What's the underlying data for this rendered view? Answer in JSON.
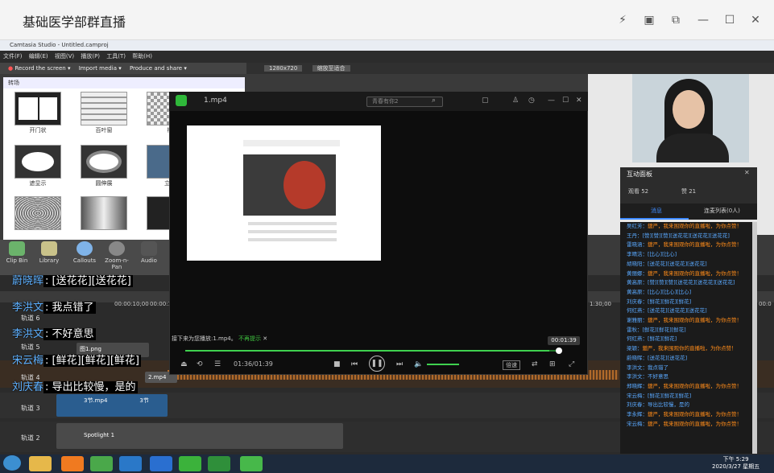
{
  "window": {
    "title": "基础医学部群直播"
  },
  "camtasia": {
    "title": "Camtasia Studio - Untitled.camproj",
    "menu": [
      "文件(F)",
      "编辑(E)",
      "视图(V)",
      "播放(P)",
      "工具(T)",
      "帮助(H)"
    ],
    "toolbar": [
      "Record the screen ▾",
      "Import media ▾",
      "Produce and share ▾"
    ],
    "resolution": "1280x720",
    "zoom": "缩放至适合",
    "gallery_header": "转场",
    "transitions": [
      "开门状",
      "百叶窗",
      "椭",
      "遮显示",
      "圆伸展",
      "立方",
      "",
      "",
      ""
    ],
    "tasks": [
      "Clip Bin",
      "Library",
      "Callouts",
      "Zoom-n-Pan",
      "Audio"
    ],
    "tracks": [
      "轨道 6",
      "轨道 5",
      "轨道 4",
      "轨道 3",
      "轨道 2"
    ],
    "timecodes": [
      "00:00:10;00",
      "00:00:1",
      "1:30;00",
      "00:0"
    ],
    "clips": [
      "3节.mp4",
      "3节",
      "Spotlight 1",
      "图1.png",
      "2.mp4"
    ]
  },
  "player": {
    "file": "1.mp4",
    "search_placeholder": "青春有你2",
    "next_note": "接下来为您播放:1.mp4。",
    "next_note_link": "不再提示",
    "time_badge": "00:01:39",
    "time": "01:36/01:39",
    "progress": 0.97,
    "speed": "倍速"
  },
  "panel": {
    "title": "互动面板",
    "viewers": "观看 52",
    "likes": "赞 21",
    "tab_messages": "消息",
    "tab_mic": "连麦列表(0人)"
  },
  "chat": [
    {
      "name": "吴红芳",
      "text": "鍍严，我来围观你的直播啦，为你点赞！",
      "color": "#ff8c1a"
    },
    {
      "name": "王丹",
      "text": "[赞][赞][赞][送花花][送花花][送花花]",
      "color": "#5aa9ff"
    },
    {
      "name": "雷晓涵",
      "text": "鍍严，我来围观你的直播啦，为你点赞！",
      "color": "#ff8c1a"
    },
    {
      "name": "李晴洁",
      "text": "[比心][比心]",
      "color": "#5aa9ff"
    },
    {
      "name": "胡晓阳",
      "text": "[送花花][送花花][送花花]",
      "color": "#5aa9ff"
    },
    {
      "name": "黄丽娜",
      "text": "鍍严，我来围观你的直播啦，为你点赞！",
      "color": "#ff8c1a"
    },
    {
      "name": "黄高原",
      "text": "[赞][赞][赞][送花花][送花花][送花花]",
      "color": "#5aa9ff"
    },
    {
      "name": "黄高原",
      "text": "[比心][比心][比心]",
      "color": "#5aa9ff"
    },
    {
      "name": "刘庆春",
      "text": "[鲜花][鲜花][鲜花]",
      "color": "#5aa9ff"
    },
    {
      "name": "何红燕",
      "text": "[送花花][送花花][送花花]",
      "color": "#5aa9ff"
    },
    {
      "name": "谢雅丽",
      "text": "鍍严，我来围观你的直播啦，为你点赞！",
      "color": "#ff8c1a"
    },
    {
      "name": "雷秋",
      "text": "[鲜花][鲜花][鲜花]",
      "color": "#5aa9ff"
    },
    {
      "name": "何红燕",
      "text": "[鲜花][鲜花]",
      "color": "#5aa9ff"
    },
    {
      "name": "梁颖",
      "text": "鍍严，我来围观你的直播啦，为你点赞！",
      "color": "#ff8c1a"
    },
    {
      "name": "蔚晓晖",
      "text": "[送花花][送花花]",
      "color": "#5aa9ff"
    },
    {
      "name": "李洪文",
      "text": "我点错了",
      "color": "#5aa9ff"
    },
    {
      "name": "李洪文",
      "text": "不好意思",
      "color": "#5aa9ff"
    },
    {
      "name": "郑晓辉",
      "text": "鍍严，我来围观你的直播啦，为你点赞！",
      "color": "#ff8c1a"
    },
    {
      "name": "宋云梅",
      "text": "[鲜花][鲜花][鲜花]",
      "color": "#5aa9ff"
    },
    {
      "name": "刘庆春",
      "text": "导出比较慢，是的",
      "color": "#5aa9ff"
    },
    {
      "name": "李永辉",
      "text": "鍍严，我来围观你的直播啦，为你点赞！",
      "color": "#ff8c1a"
    },
    {
      "name": "宋云梅",
      "text": "鍍严，我来围观你的直播啦，为你点赞！",
      "color": "#ff8c1a"
    }
  ],
  "danmaku": [
    {
      "name": "蔚晓晖",
      "text": "[送花花][送花花]"
    },
    {
      "name": "李洪文",
      "text": "我点错了"
    },
    {
      "name": "李洪文",
      "text": "不好意思"
    },
    {
      "name": "宋云梅",
      "text": "[鲜花][鲜花][鲜花]"
    },
    {
      "name": "刘庆春",
      "text": "导出比较慢，是的"
    }
  ],
  "clock": {
    "time": "下午 5:29",
    "date": "2020/3/27 星期五"
  }
}
